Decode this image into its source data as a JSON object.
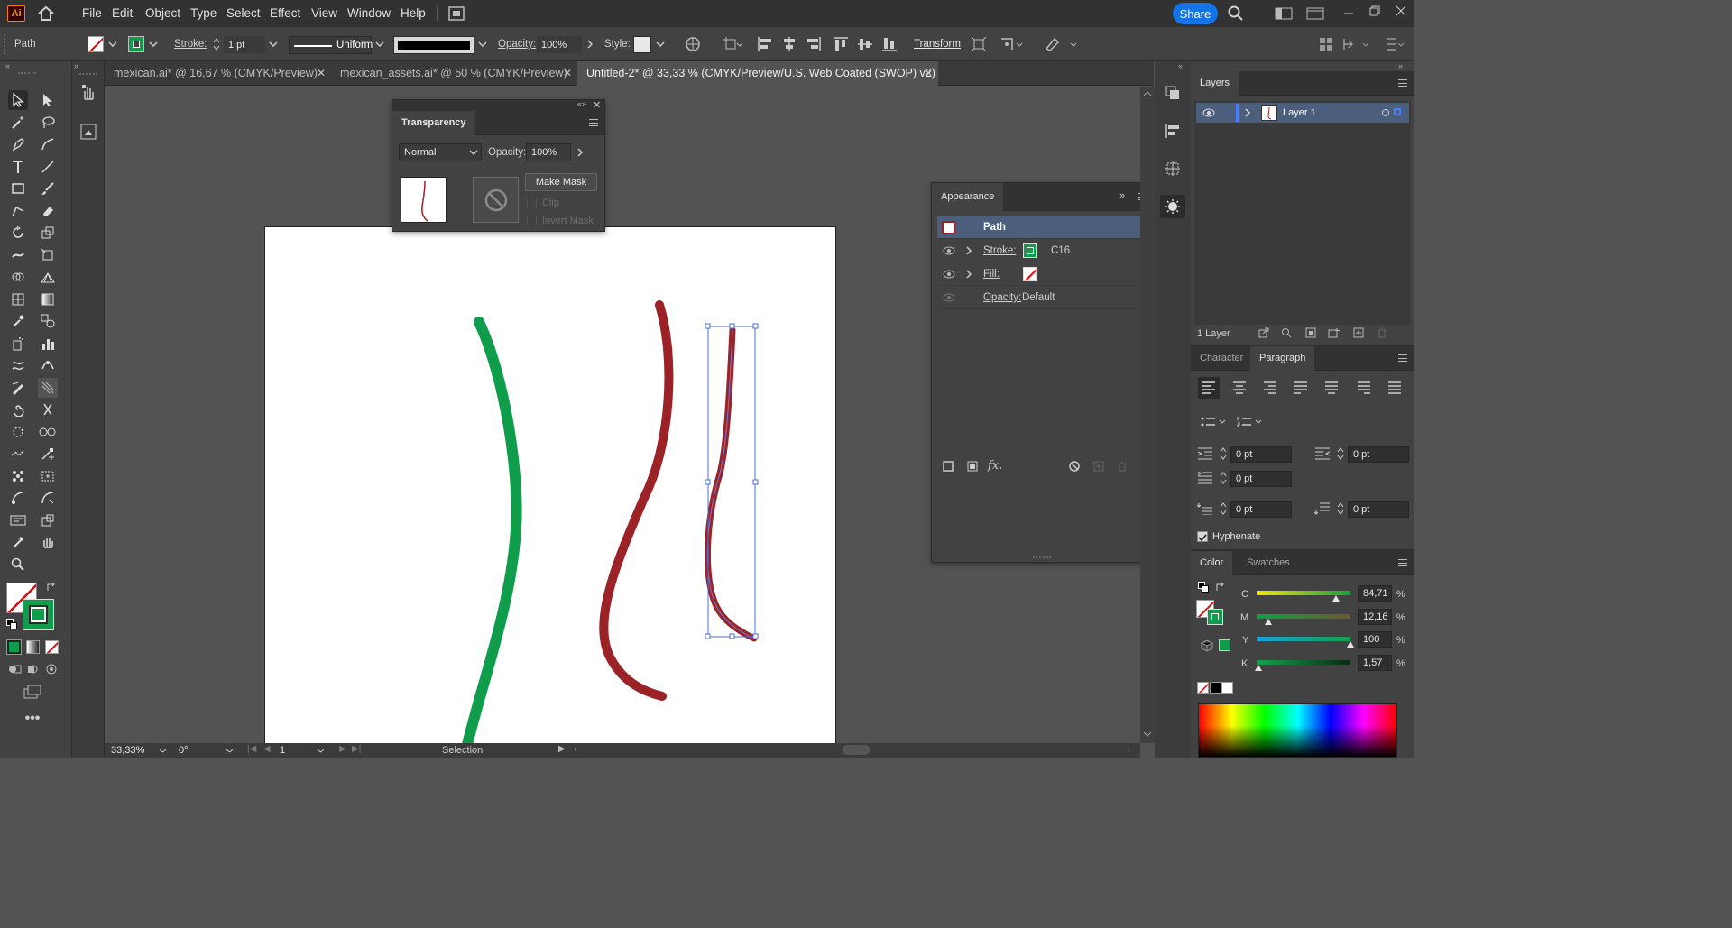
{
  "app": {
    "logo": "Ai"
  },
  "menu": [
    "File",
    "Edit",
    "Object",
    "Type",
    "Select",
    "Effect",
    "View",
    "Window",
    "Help"
  ],
  "share_label": "Share",
  "control": {
    "selection_type": "Path",
    "stroke_label": "Stroke:",
    "stroke_value": "1 pt",
    "profile_label": "Uniform",
    "opacity_label": "Opacity:",
    "opacity_value": "100%",
    "style_label": "Style:",
    "transform_label": "Transform"
  },
  "tabs": [
    {
      "label": "mexican.ai* @ 16,67 % (CMYK/Preview)",
      "active": false
    },
    {
      "label": "mexican_assets.ai* @ 50 % (CMYK/Preview)",
      "active": false
    },
    {
      "label": "Untitled-2* @ 33,33 % (CMYK/Preview/U.S. Web Coated (SWOP) v2)",
      "active": true
    }
  ],
  "transparency": {
    "title": "Transparency",
    "blend_mode": "Normal",
    "opacity_label": "Opacity:",
    "opacity_value": "100%",
    "make_mask": "Make Mask",
    "clip": "Clip",
    "invert_mask": "Invert Mask"
  },
  "appearance": {
    "title": "Appearance",
    "header": "Path",
    "stroke_label": "Stroke:",
    "stroke_value": "C16",
    "fill_label": "Fill:",
    "opacity_label": "Opacity:",
    "opacity_value": "Default"
  },
  "layers": {
    "title": "Layers",
    "layer_name": "Layer 1",
    "count": "1 Layer"
  },
  "char_para": {
    "tab_character": "Character",
    "tab_paragraph": "Paragraph",
    "indent_left": "0 pt",
    "indent_right": "0 pt",
    "indent_first": "0 pt",
    "space_before": "0 pt",
    "space_after": "0 pt",
    "hyphenate": "Hyphenate"
  },
  "color": {
    "tab_color": "Color",
    "tab_swatches": "Swatches",
    "channels": [
      {
        "name": "C",
        "value": "84,71",
        "fraction": 0.8471
      },
      {
        "name": "M",
        "value": "12,16",
        "fraction": 0.1216
      },
      {
        "name": "Y",
        "value": "100",
        "fraction": 1.0
      },
      {
        "name": "K",
        "value": "1,57",
        "fraction": 0.0157
      }
    ],
    "unit": "%"
  },
  "status": {
    "zoom": "33,33%",
    "rotation": "0°",
    "artboard": "1",
    "tool": "Selection"
  },
  "colors": {
    "stroke_green": "#0f9d4b",
    "path_red": "#9b2226",
    "accent_blue": "#1473e6",
    "selection_blue": "#4a6fd6"
  }
}
